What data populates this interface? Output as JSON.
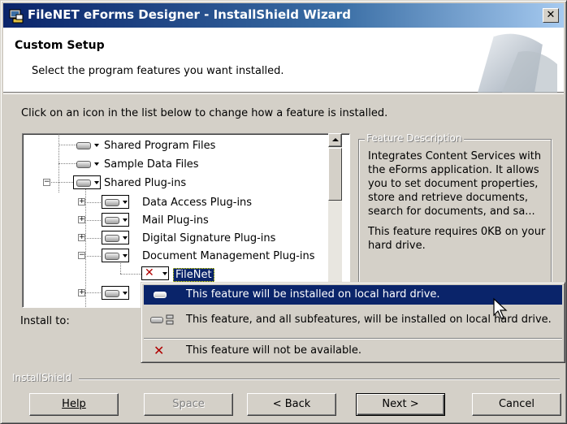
{
  "window": {
    "title": "FileNET eForms Designer - InstallShield Wizard",
    "close_glyph": "✕"
  },
  "banner": {
    "heading": "Custom Setup",
    "subtitle": "Select the program features you want installed."
  },
  "instruction": "Click on an icon in the list below to change how a feature is installed.",
  "tree": {
    "items": [
      {
        "label": "Shared Program Files",
        "state": "install-local"
      },
      {
        "label": "Sample Data Files",
        "state": "install-local"
      },
      {
        "label": "Shared Plug-ins",
        "state": "install-local",
        "expander": "−"
      },
      {
        "label": "Data Access Plug-ins",
        "state": "install-local",
        "expander": "+"
      },
      {
        "label": "Mail Plug-ins",
        "state": "install-local",
        "expander": "+"
      },
      {
        "label": "Digital Signature Plug-ins",
        "state": "install-local",
        "expander": "+"
      },
      {
        "label": "Document Management Plug-ins",
        "state": "install-local",
        "expander": "−"
      },
      {
        "label": "FileNet",
        "state": "not-available",
        "selected": true
      },
      {
        "label": "",
        "state": "install-local",
        "expander": "+"
      }
    ]
  },
  "feature_description": {
    "legend": "Feature Description",
    "description": "Integrates Content Services with the eForms application. It allows you to set document properties, store and retrieve documents, search for documents, and sa...",
    "requirement": "This feature requires 0KB on your hard drive."
  },
  "install_to_label": "Install to:",
  "dropdown_menu": {
    "items": [
      {
        "text": "This feature will be installed on local hard drive.",
        "icon": "hard-drive-icon",
        "highlighted": true
      },
      {
        "text": "This feature, and all subfeatures, will be installed on local hard drive.",
        "icon": "hard-drive-subfeatures-icon",
        "highlighted": false
      },
      {
        "text": "This feature will not be available.",
        "icon": "red-x-icon",
        "highlighted": false
      }
    ],
    "x_glyph": "✕"
  },
  "footer": {
    "brand": "InstallShield",
    "buttons": {
      "help": "Help",
      "space": "Space",
      "back": "< Back",
      "next": "Next >",
      "cancel": "Cancel"
    }
  }
}
